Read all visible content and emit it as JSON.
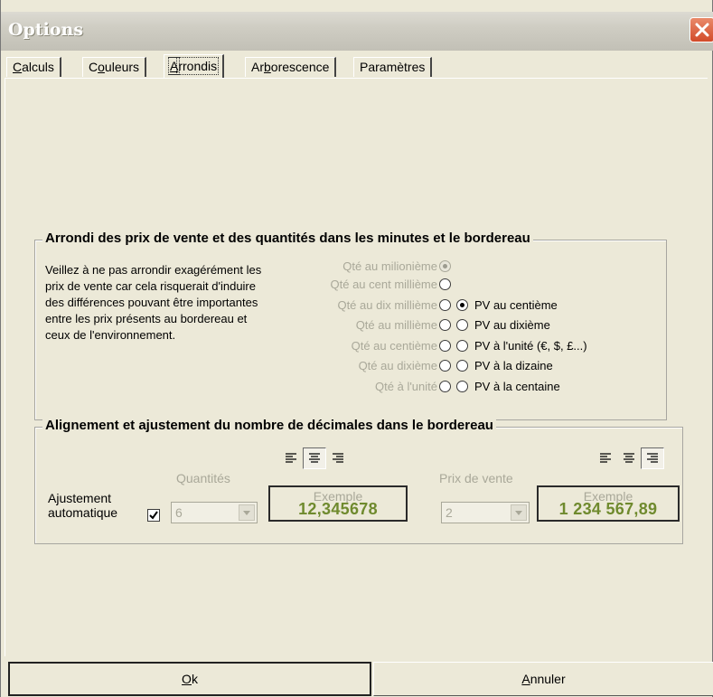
{
  "window": {
    "title": "Options"
  },
  "tabs": [
    {
      "label": "Calculs",
      "accel": "C",
      "rest": "alculs"
    },
    {
      "label": "Couleurs",
      "accel": "o",
      "pre": "C",
      "rest": "uleurs"
    },
    {
      "label": "Arrondis",
      "accel": "A",
      "rest": "rrondis",
      "active": true
    },
    {
      "label": "Arborescence",
      "pre": "Ar",
      "accel": "b",
      "rest": "orescence"
    },
    {
      "label": "Paramètres"
    }
  ],
  "rounding_group": {
    "title": "Arrondi des prix de vente et des quantités dans les minutes et le bordereau",
    "note": "Veillez à ne pas arrondir exagérément les prix de vente car cela risquerait d'induire des différences pouvant être importantes entre les prix présents au bordereau et ceux de l'environnement.",
    "quantity_options": [
      {
        "label": "Qté au milionième",
        "selected": true,
        "enabled": false
      },
      {
        "label": "Qté au cent millième",
        "selected": false,
        "enabled": false
      },
      {
        "label": "Qté au dix millième",
        "selected": false,
        "enabled": false
      },
      {
        "label": "Qté au millième",
        "selected": false,
        "enabled": false
      },
      {
        "label": "Qté au centième",
        "selected": false,
        "enabled": false
      },
      {
        "label": "Qté au dixième",
        "selected": false,
        "enabled": false
      },
      {
        "label": "Qté à l'unité",
        "selected": false,
        "enabled": false
      }
    ],
    "price_options": [
      {
        "label": "PV au centième",
        "selected": true
      },
      {
        "label": "PV au dixième",
        "selected": false
      },
      {
        "label": "PV à l'unité (€, $, £...)",
        "selected": false
      },
      {
        "label": "PV à la dizaine",
        "selected": false
      },
      {
        "label": "PV à la centaine",
        "selected": false
      }
    ]
  },
  "alignment_group": {
    "title": "Alignement et ajustement du nombre de décimales dans le bordereau",
    "auto_adjust_label_1": "Ajustement",
    "auto_adjust_label_2": "automatique",
    "auto_adjust_checked": true,
    "quantities": {
      "label": "Quantités",
      "decimals": "6",
      "alignment_selected": "center",
      "example_title": "Exemple",
      "example_value": "12,345678"
    },
    "prices": {
      "label": "Prix de vente",
      "decimals": "2",
      "alignment_selected": "right",
      "example_title": "Exemple",
      "example_value": "1 234 567,89"
    }
  },
  "buttons": {
    "ok_accel": "O",
    "ok_rest": "k",
    "cancel_accel": "A",
    "cancel_rest": "nnuler"
  },
  "colors": {
    "dialog_bg": "#ece9d8",
    "disabled_text": "#a9a899",
    "example_value": "#6f8a2e",
    "close_button": "#d24b2a"
  },
  "icons": [
    "close-icon",
    "align-left-icon",
    "align-center-icon",
    "align-right-icon",
    "checkmark-icon",
    "dropdown-arrow-icon"
  ]
}
